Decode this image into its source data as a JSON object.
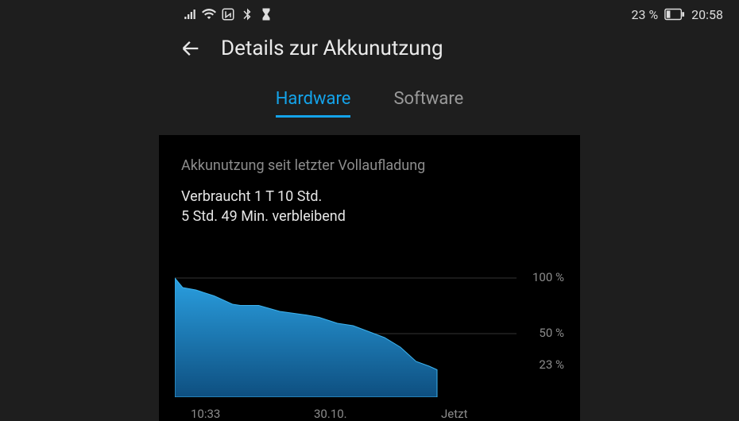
{
  "statusbar": {
    "battery_text": "23 %",
    "clock": "20:58"
  },
  "header": {
    "title": "Details zur Akkunutzung"
  },
  "tabs": {
    "hardware": "Hardware",
    "software": "Software",
    "active": "hardware"
  },
  "section": {
    "title": "Akkunutzung seit letzter Vollaufladung",
    "consumed": "Verbraucht 1 T 10 Std.",
    "remaining": "5 Std. 49 Min. verbleibend"
  },
  "chart_data": {
    "type": "area",
    "title": "Akkunutzung seit letzter Vollaufladung",
    "xlabel": "",
    "ylabel": "",
    "ylim": [
      0,
      100
    ],
    "x_ticks": [
      "10:33",
      "30.10.",
      "Jetzt"
    ],
    "y_ticks": [
      100,
      50,
      23
    ],
    "y_tick_labels": [
      "100 %",
      "50 %",
      "23 %"
    ],
    "series": [
      {
        "name": "battery-level",
        "color": "#1d7fc4",
        "x": [
          0,
          0.03,
          0.08,
          0.15,
          0.22,
          0.25,
          0.32,
          0.4,
          0.5,
          0.55,
          0.62,
          0.68,
          0.74,
          0.8,
          0.86,
          0.92,
          0.97,
          1.0
        ],
        "values": [
          100,
          92,
          90,
          85,
          78,
          77,
          77,
          72,
          69,
          67,
          62,
          60,
          55,
          50,
          42,
          30,
          26,
          23
        ]
      }
    ]
  }
}
